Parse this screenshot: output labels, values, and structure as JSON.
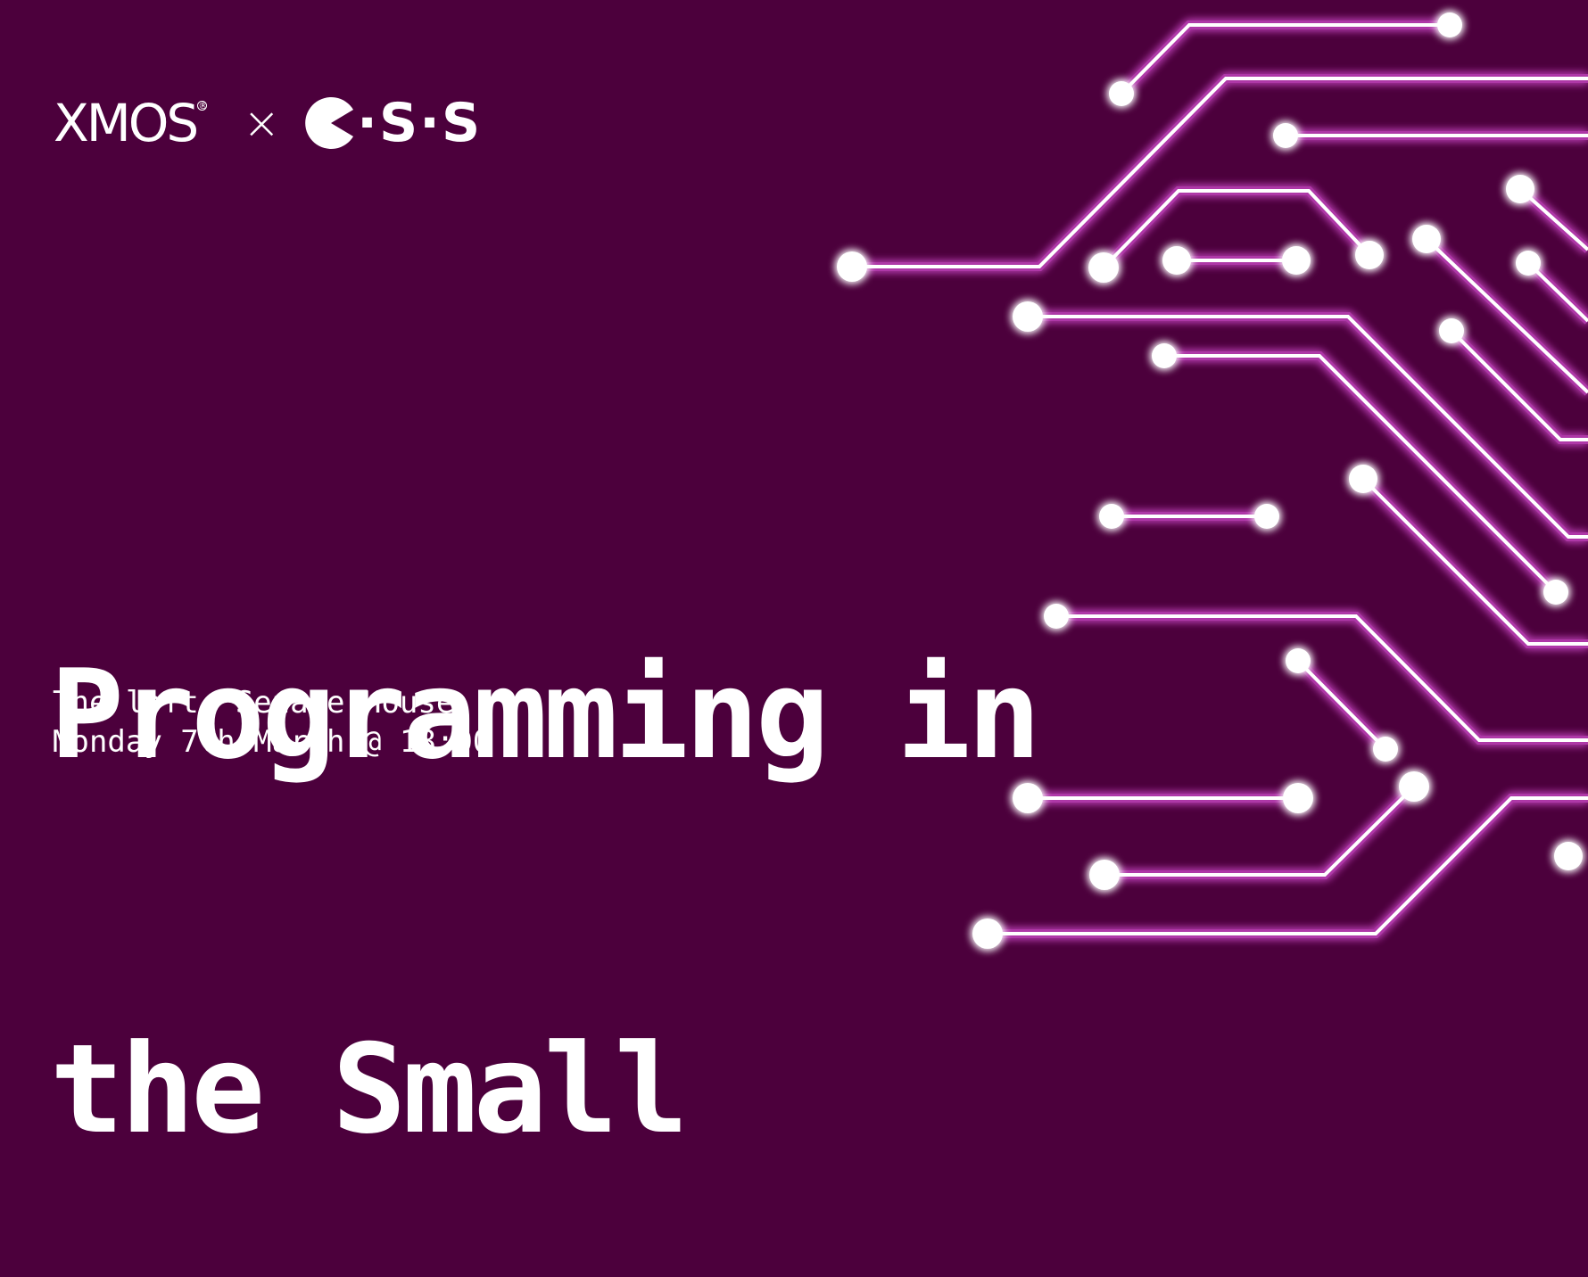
{
  "logos": {
    "xmos": "XMOS",
    "registered": "®",
    "separator": "×",
    "css": "·S·S"
  },
  "title": {
    "line1": "Programming in",
    "line2": "the Small"
  },
  "details": {
    "venue": "The loft, Senate House",
    "datetime": "Monday 7th March @ 18:00"
  },
  "colors": {
    "background": "#4c003c",
    "circuit": "#ff4dff",
    "text": "#ffffff"
  }
}
